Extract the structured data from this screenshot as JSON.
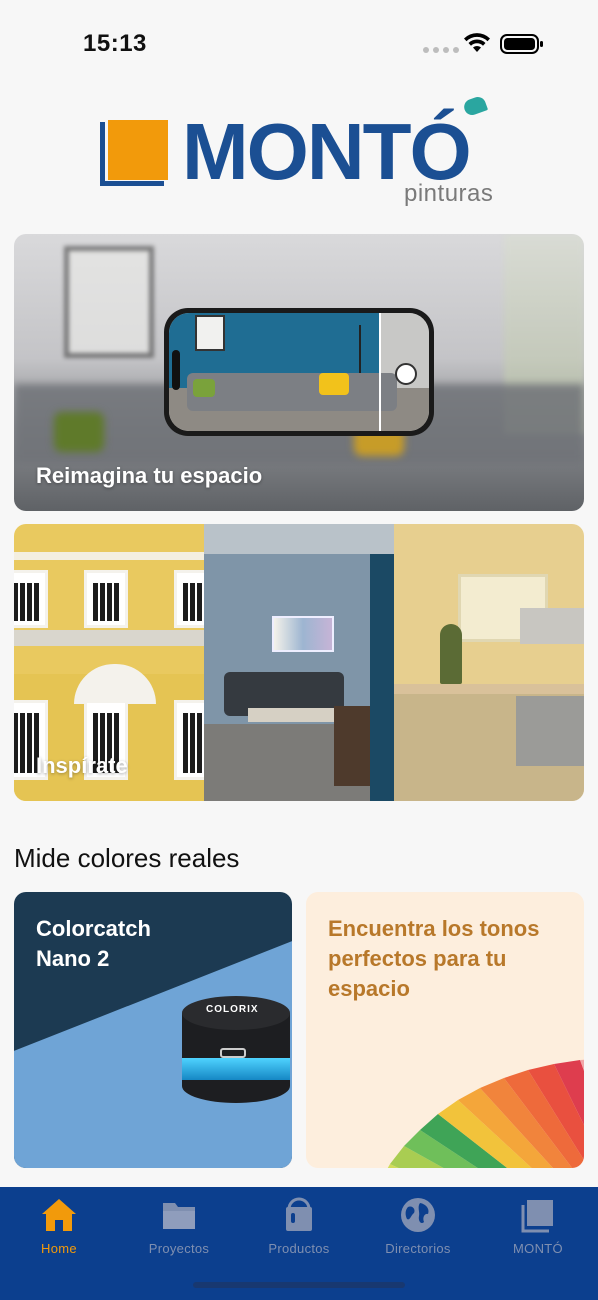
{
  "status_bar": {
    "time": "15:13"
  },
  "brand": {
    "name": "MONTÓ",
    "tagline": "pinturas",
    "colors": {
      "blue": "#1b4f93",
      "orange": "#f29a0b",
      "teal": "#2aa6a0"
    }
  },
  "hero_cards": [
    {
      "label": "Reimagina tu espacio"
    },
    {
      "label": "Inspírate"
    }
  ],
  "section": {
    "title": "Mide colores reales"
  },
  "color_cards": {
    "nano": {
      "title_line1": "Colorcatch",
      "title_line2": "Nano 2",
      "device_brand": "COLORIX"
    },
    "tonos": {
      "title": "Encuentra los tonos perfectos para tu espacio"
    }
  },
  "tab_bar": {
    "items": [
      {
        "label": "Home",
        "icon": "home-icon",
        "active": true
      },
      {
        "label": "Proyectos",
        "icon": "folder-icon",
        "active": false
      },
      {
        "label": "Productos",
        "icon": "paint-can-icon",
        "active": false
      },
      {
        "label": "Directorios",
        "icon": "globe-icon",
        "active": false
      },
      {
        "label": "MONTÓ",
        "icon": "square-icon",
        "active": false
      }
    ],
    "colors": {
      "active": "#f29a0b",
      "inactive": "#7f8fb0",
      "background": "#0c3f8e"
    }
  }
}
